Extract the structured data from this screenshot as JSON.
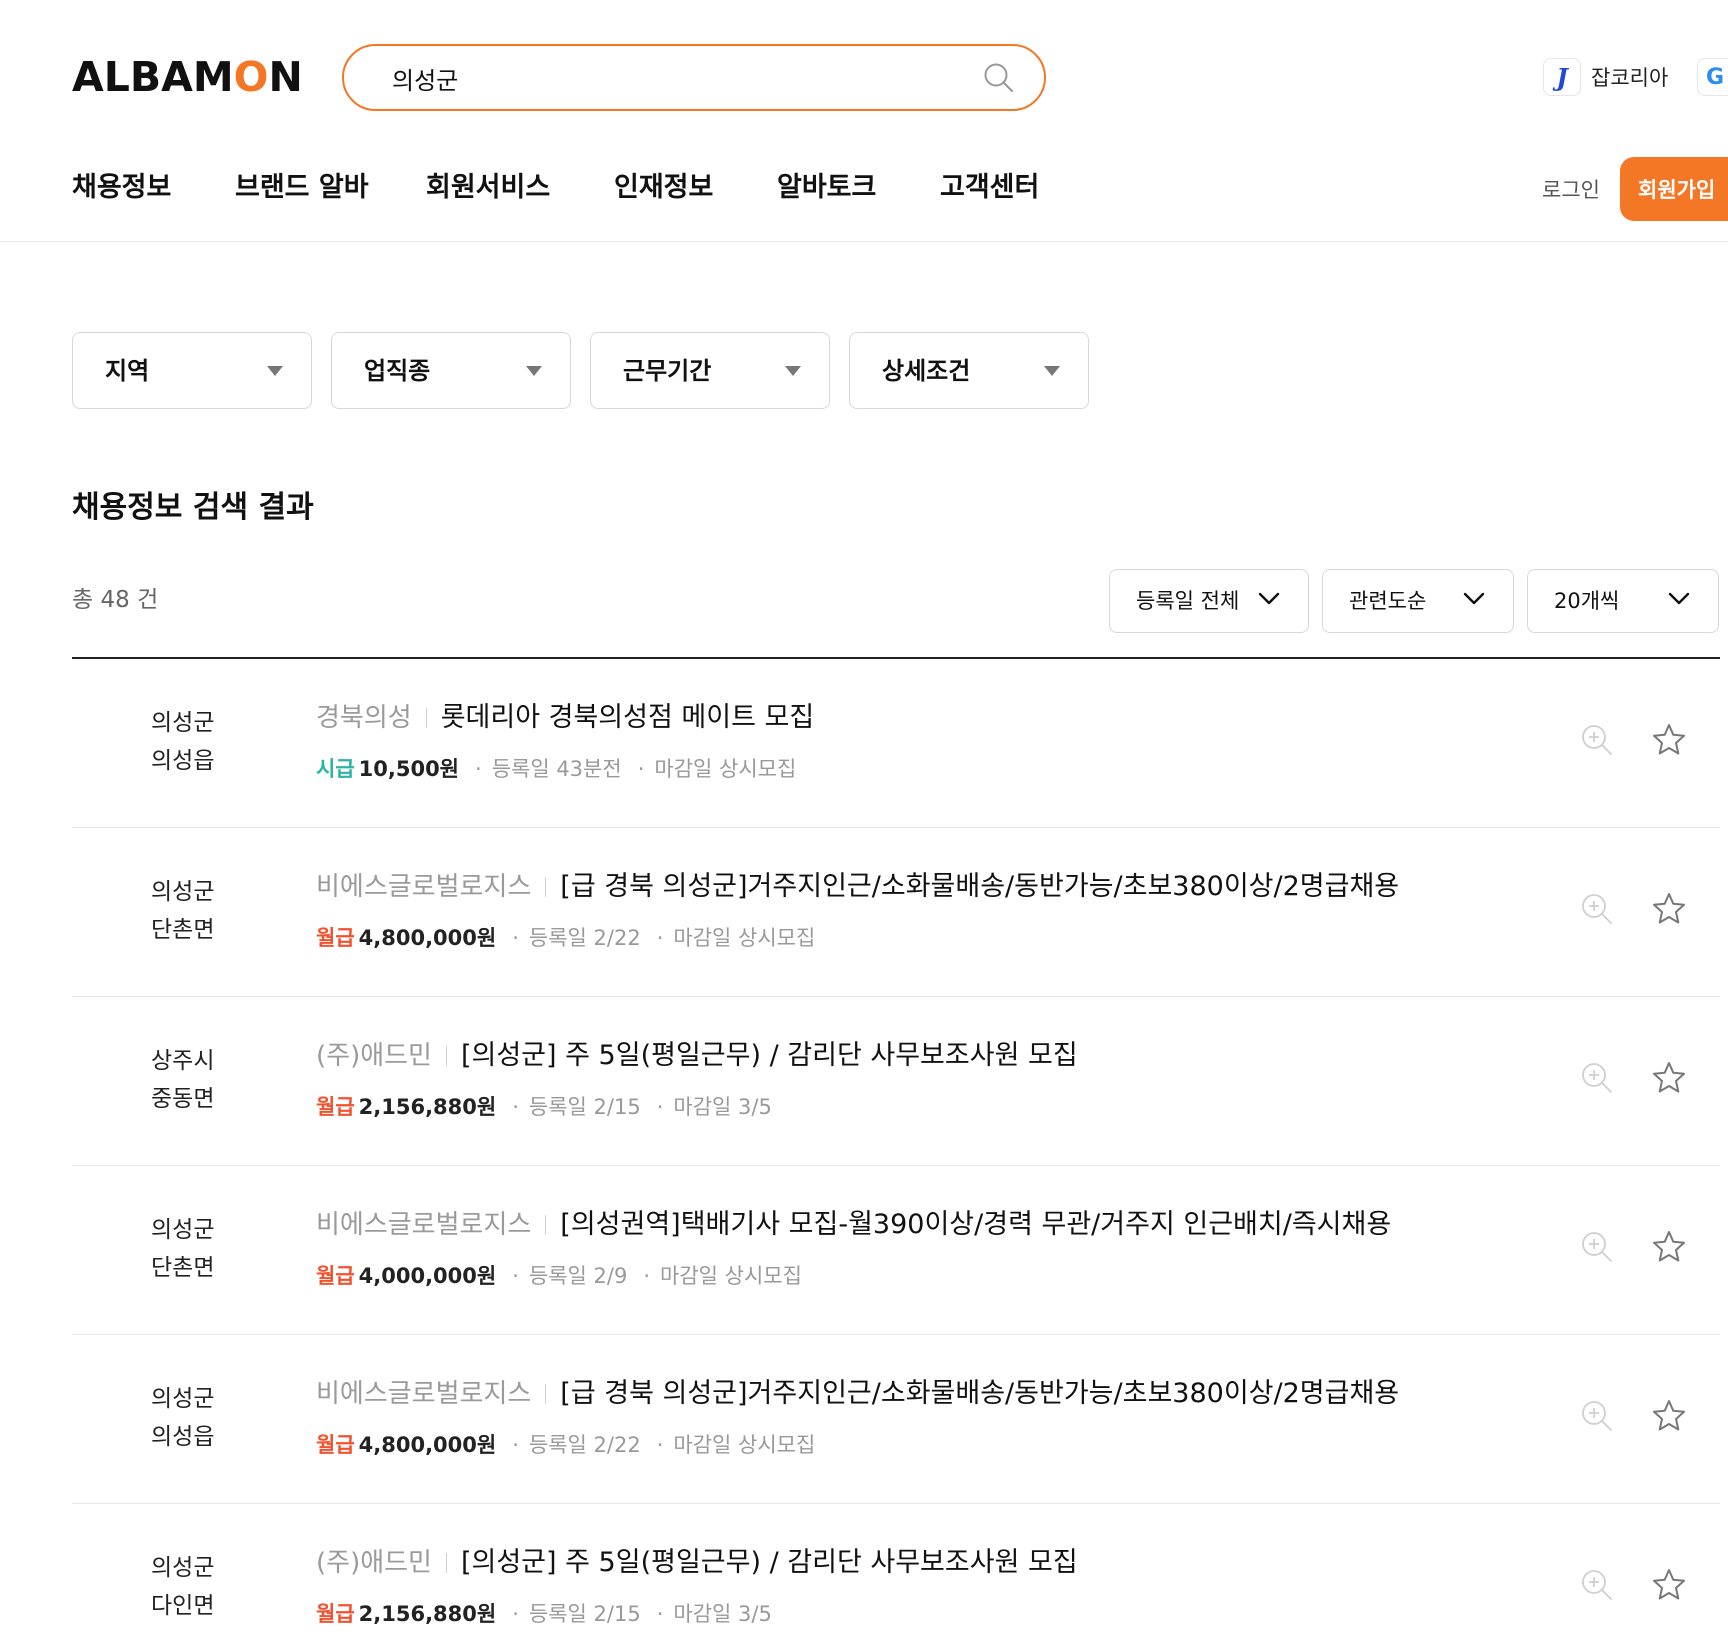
{
  "brand": {
    "logo_prefix": "ALBAM",
    "logo_o": "O",
    "logo_suffix": "N",
    "accent_color": "#f47725"
  },
  "search": {
    "value": "의성군",
    "icon": "search-icon"
  },
  "partners": {
    "jobkorea_badge": "J",
    "jobkorea_label": "잡코리아",
    "second_badge": "G"
  },
  "nav": {
    "items": [
      {
        "label": "채용정보"
      },
      {
        "label": "브랜드 알바"
      },
      {
        "label": "회원서비스"
      },
      {
        "label": "인재정보"
      },
      {
        "label": "알바토크"
      },
      {
        "label": "고객센터"
      }
    ],
    "login": "로그인",
    "signup": "회원가입"
  },
  "filters": [
    {
      "label": "지역"
    },
    {
      "label": "업직종"
    },
    {
      "label": "근무기간"
    },
    {
      "label": "상세조건"
    }
  ],
  "results": {
    "title": "채용정보 검색 결과",
    "total_prefix": "총",
    "total_count": "48",
    "total_suffix": "건",
    "sorts": [
      {
        "label": "등록일 전체"
      },
      {
        "label": "관련도순"
      },
      {
        "label": "20개씩"
      }
    ],
    "pay_colors": {
      "hourly": "#2bb3a3",
      "monthly": "#f2532f"
    },
    "items": [
      {
        "loc1": "의성군",
        "loc2": "의성읍",
        "company": "경북의성",
        "title": "롯데리아 경북의성점 메이트 모집",
        "pay_type": "시급",
        "pay_kind": "hourly",
        "pay": "10,500원",
        "registered": "등록일 43분전",
        "deadline": "마감일 상시모집"
      },
      {
        "loc1": "의성군",
        "loc2": "단촌면",
        "company": "비에스글로벌로지스",
        "title": "[급 경북 의성군]거주지인근/소화물배송/동반가능/초보380이상/2명급채용",
        "pay_type": "월급",
        "pay_kind": "monthly",
        "pay": "4,800,000원",
        "registered": "등록일 2/22",
        "deadline": "마감일 상시모집"
      },
      {
        "loc1": "상주시",
        "loc2": "중동면",
        "company": "(주)애드민",
        "title": "[의성군] 주 5일(평일근무) / 감리단 사무보조사원 모집",
        "pay_type": "월급",
        "pay_kind": "monthly",
        "pay": "2,156,880원",
        "registered": "등록일 2/15",
        "deadline": "마감일 3/5"
      },
      {
        "loc1": "의성군",
        "loc2": "단촌면",
        "company": "비에스글로벌로지스",
        "title": "[의성권역]택배기사 모집-월390이상/경력 무관/거주지 인근배치/즉시채용",
        "pay_type": "월급",
        "pay_kind": "monthly",
        "pay": "4,000,000원",
        "registered": "등록일 2/9",
        "deadline": "마감일 상시모집"
      },
      {
        "loc1": "의성군",
        "loc2": "의성읍",
        "company": "비에스글로벌로지스",
        "title": "[급 경북 의성군]거주지인근/소화물배송/동반가능/초보380이상/2명급채용",
        "pay_type": "월급",
        "pay_kind": "monthly",
        "pay": "4,800,000원",
        "registered": "등록일 2/22",
        "deadline": "마감일 상시모집"
      },
      {
        "loc1": "의성군",
        "loc2": "다인면",
        "company": "(주)애드민",
        "title": "[의성군] 주 5일(평일근무) / 감리단 사무보조사원 모집",
        "pay_type": "월급",
        "pay_kind": "monthly",
        "pay": "2,156,880원",
        "registered": "등록일 2/15",
        "deadline": "마감일 3/5"
      }
    ]
  }
}
